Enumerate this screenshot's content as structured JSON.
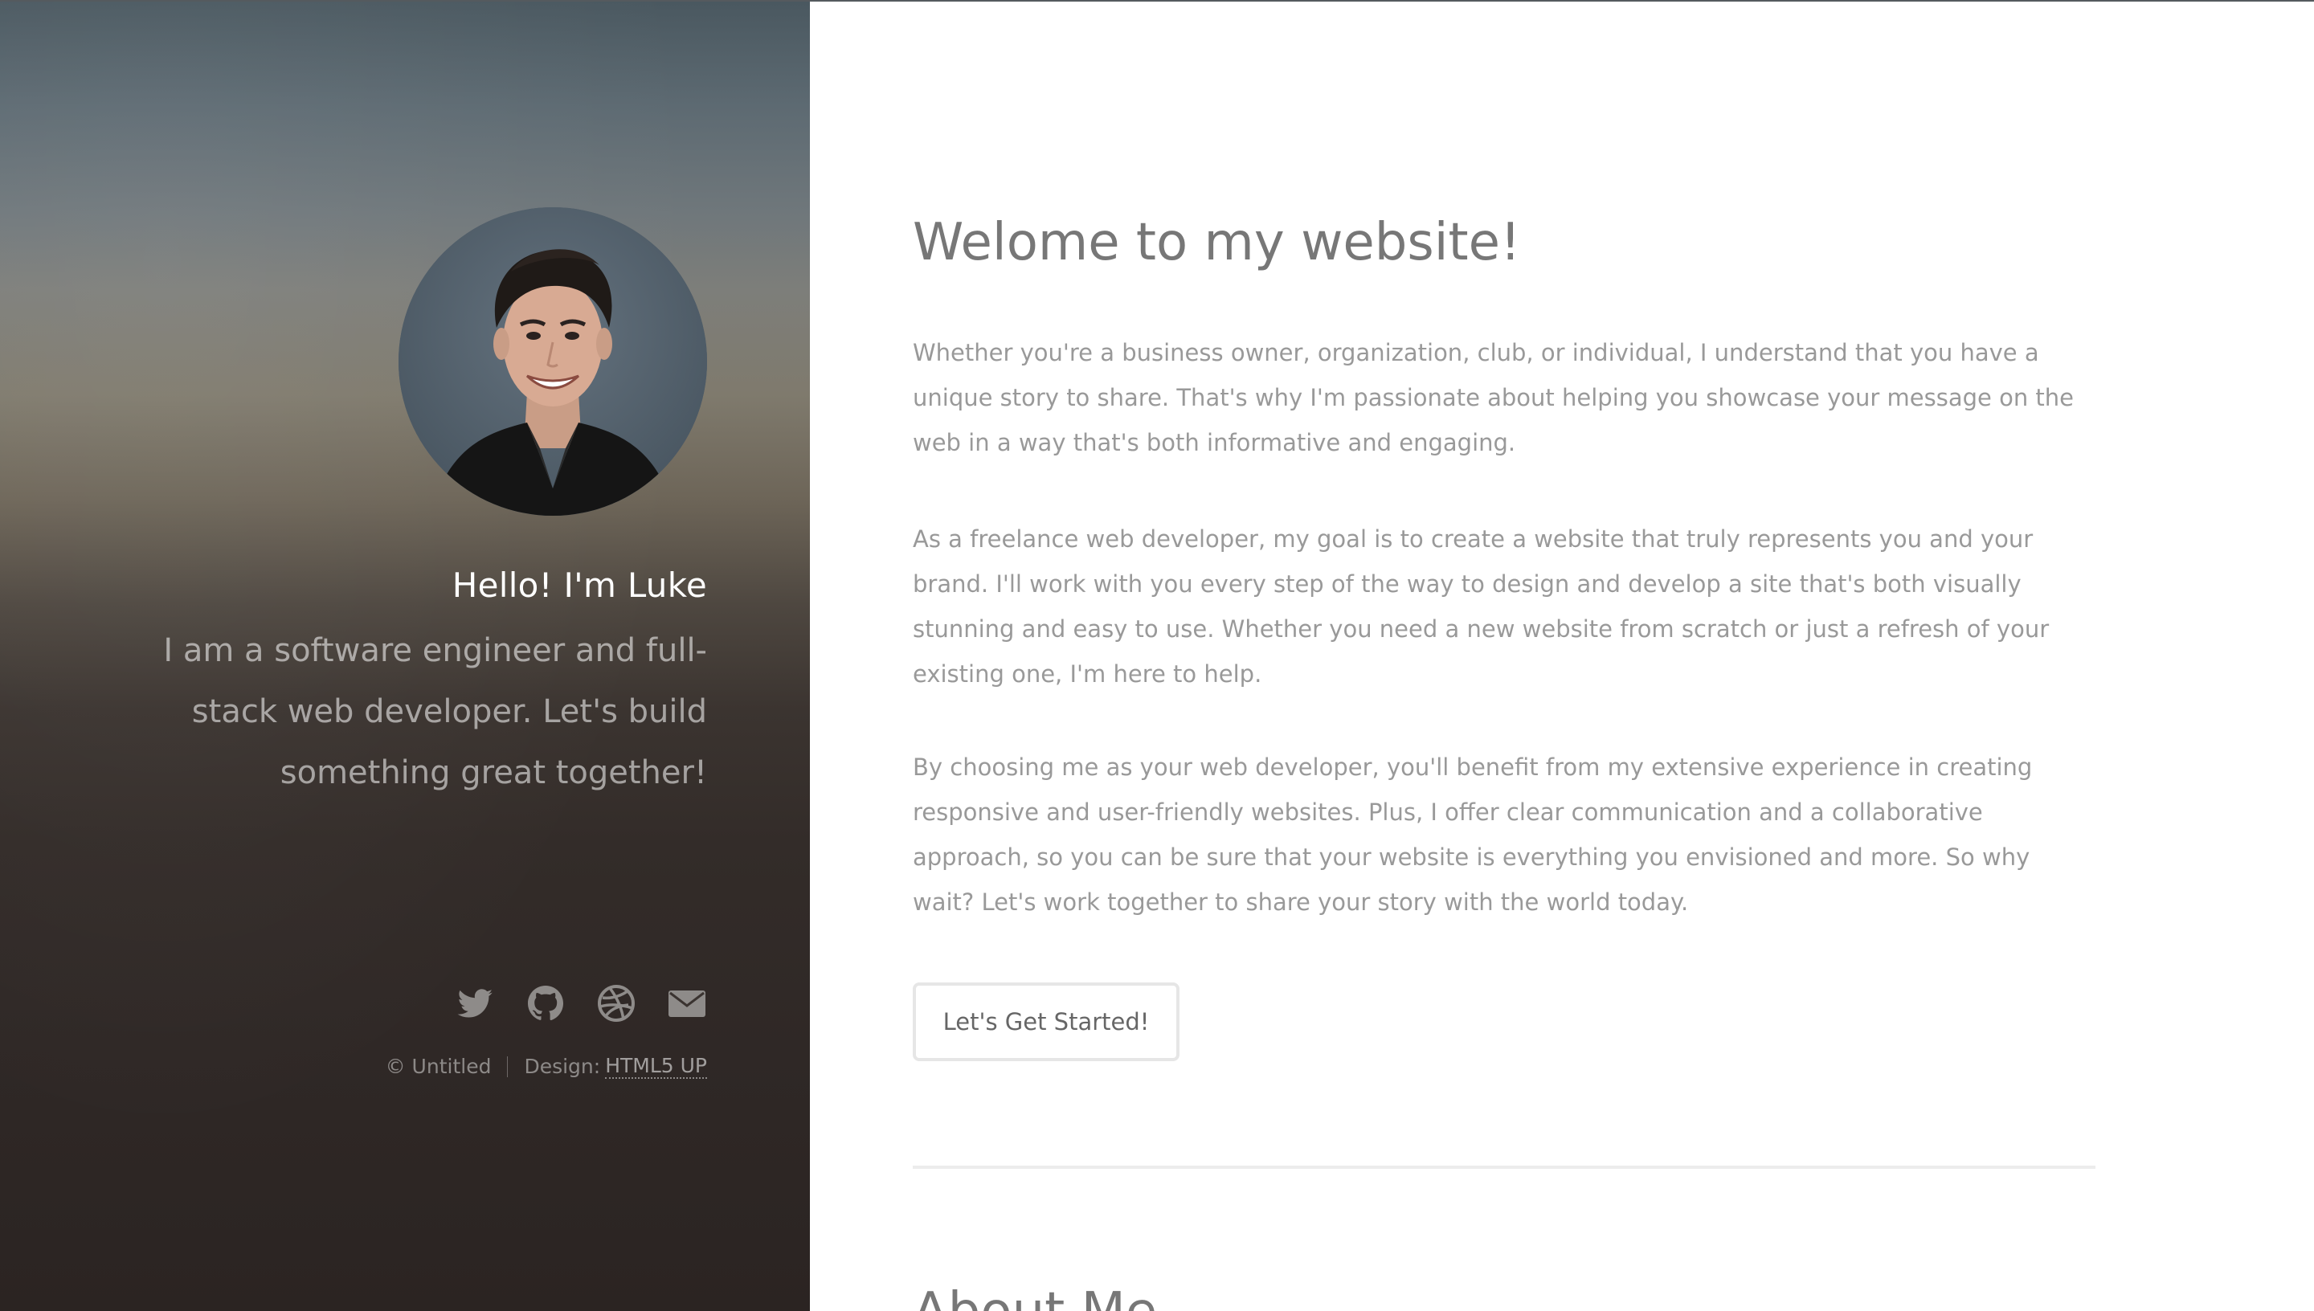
{
  "sidebar": {
    "hello": "Hello! I'm Luke",
    "intro": "I am a software engineer and full-stack web developer. Let's build something great together!",
    "social": [
      {
        "icon": "twitter-icon"
      },
      {
        "icon": "github-icon"
      },
      {
        "icon": "dribbble-icon"
      },
      {
        "icon": "envelope-icon"
      }
    ],
    "copyright": "© Untitled",
    "design_label": "Design:",
    "design_link": "HTML5 UP"
  },
  "main": {
    "title": "Welome to my website!",
    "paragraphs": [
      "Whether you're a business owner, organization, club, or individual, I understand that you have a unique story to share. That's why I'm passionate about helping you showcase your message on the web in a way that's both informative and engaging.",
      "As a freelance web developer, my goal is to create a website that truly represents you and your brand. I'll work with you every step of the way to design and develop a site that's both visually stunning and easy to use. Whether you need a new website from scratch or just a refresh of your existing one, I'm here to help.",
      "By choosing me as your web developer, you'll benefit from my extensive experience in creating responsive and user-friendly websites. Plus, I offer clear communication and a collaborative approach, so you can be sure that your website is everything you envisioned and more. So why wait? Let's work together to share your story with the world today."
    ],
    "cta_label": "Let's Get Started!",
    "about_title": "About Me"
  },
  "colors": {
    "heading": "#777777",
    "body_text": "#999999",
    "sidebar_text": "#ffffff"
  }
}
